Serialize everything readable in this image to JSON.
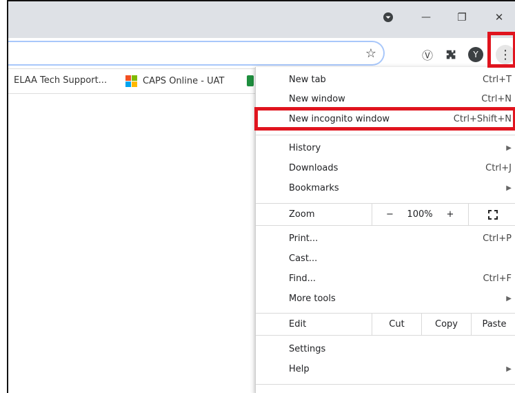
{
  "titlebar": {
    "minimize": "—",
    "restore": "❐",
    "close": "✕"
  },
  "toolbar": {
    "star": "☆",
    "extension_v": "Ⓥ",
    "puzzle": "✱",
    "profile_letter": "Y",
    "menu": "⋮"
  },
  "bookmarks": [
    {
      "label": "ELAA Tech Support..."
    },
    {
      "label": "CAPS Online - UAT"
    }
  ],
  "menu": {
    "new_tab": {
      "label": "New tab",
      "shortcut": "Ctrl+T"
    },
    "new_window": {
      "label": "New window",
      "shortcut": "Ctrl+N"
    },
    "new_incognito": {
      "label": "New incognito window",
      "shortcut": "Ctrl+Shift+N"
    },
    "history": {
      "label": "History"
    },
    "downloads": {
      "label": "Downloads",
      "shortcut": "Ctrl+J"
    },
    "bookmarks": {
      "label": "Bookmarks"
    },
    "zoom": {
      "label": "Zoom",
      "minus": "−",
      "value": "100%",
      "plus": "+"
    },
    "print": {
      "label": "Print...",
      "shortcut": "Ctrl+P"
    },
    "cast": {
      "label": "Cast..."
    },
    "find": {
      "label": "Find...",
      "shortcut": "Ctrl+F"
    },
    "more_tools": {
      "label": "More tools"
    },
    "edit": {
      "label": "Edit",
      "cut": "Cut",
      "copy": "Copy",
      "paste": "Paste"
    },
    "settings": {
      "label": "Settings"
    },
    "help": {
      "label": "Help"
    }
  },
  "colors": {
    "highlight": "#e0141e",
    "titlebar": "#dee1e6"
  }
}
